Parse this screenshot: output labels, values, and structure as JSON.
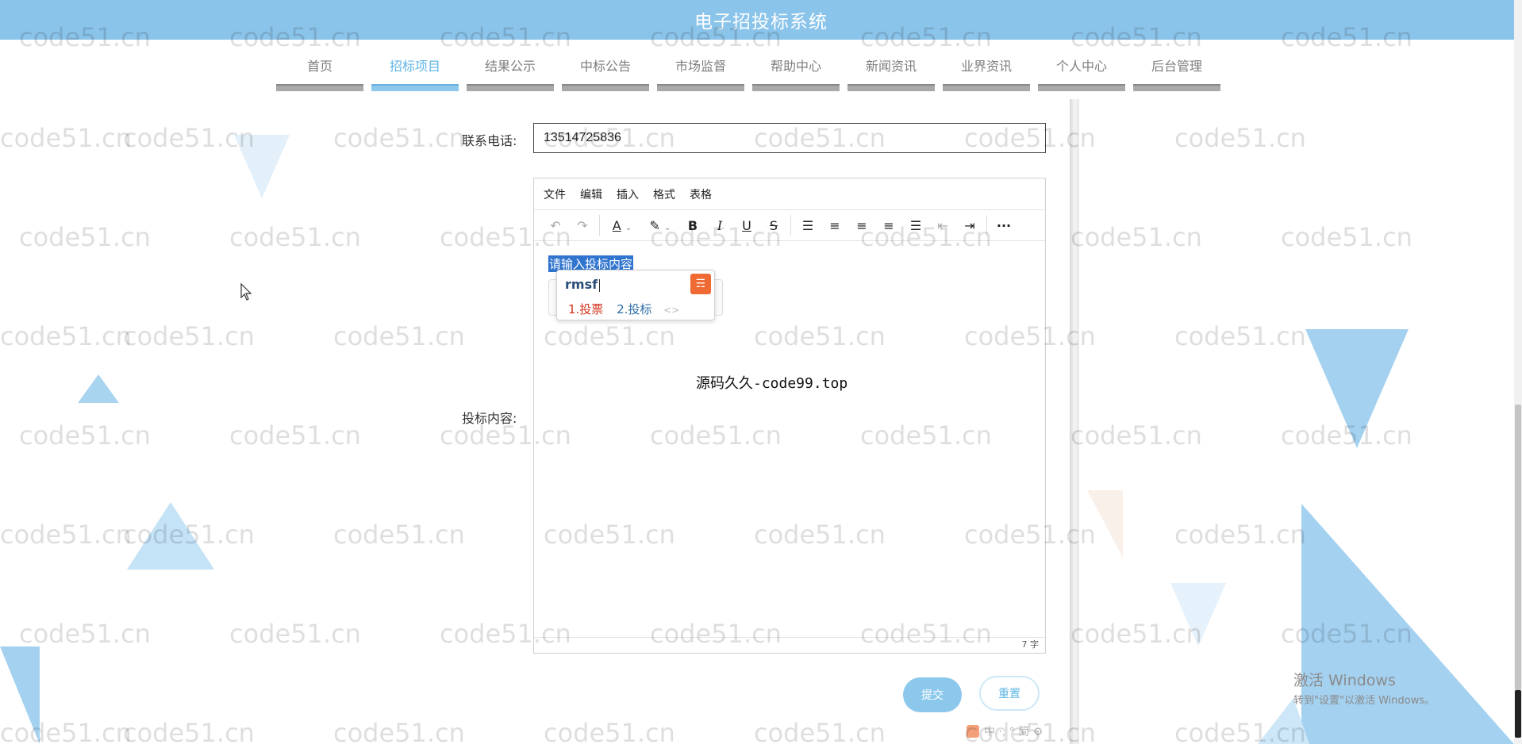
{
  "header": {
    "title": "电子招投标系统"
  },
  "nav": {
    "items": [
      {
        "label": "首页",
        "active": false
      },
      {
        "label": "招标项目",
        "active": true
      },
      {
        "label": "结果公示",
        "active": false
      },
      {
        "label": "中标公告",
        "active": false
      },
      {
        "label": "市场监督",
        "active": false
      },
      {
        "label": "帮助中心",
        "active": false
      },
      {
        "label": "新闻资讯",
        "active": false
      },
      {
        "label": "业界资讯",
        "active": false
      },
      {
        "label": "个人中心",
        "active": false
      },
      {
        "label": "后台管理",
        "active": false
      }
    ]
  },
  "form": {
    "phone_label": "联系电话:",
    "phone_value": "13514725836",
    "content_label": "投标内容:",
    "editor": {
      "menu": [
        "文件",
        "编辑",
        "插入",
        "格式",
        "表格"
      ],
      "placeholder_selected": "请输入投标内容",
      "watermark_text": "源码久久-code99.top",
      "char_count": "7 字"
    },
    "ime": {
      "code": "rmsf",
      "candidates": [
        "1.投票",
        "2.投标"
      ],
      "nav_arrows": "<>"
    },
    "submit_label": "提交",
    "reset_label": "重置"
  },
  "watermark": "code51.cn",
  "os": {
    "activate_title": "激活 Windows",
    "activate_sub": "转到\"设置\"以激活 Windows。",
    "ime_bar": "中 ·, ° 简 ⚙"
  },
  "colors": {
    "header_bg": "#8bc4ea",
    "accent": "#5fb6e4",
    "selection": "#2f74cf"
  }
}
